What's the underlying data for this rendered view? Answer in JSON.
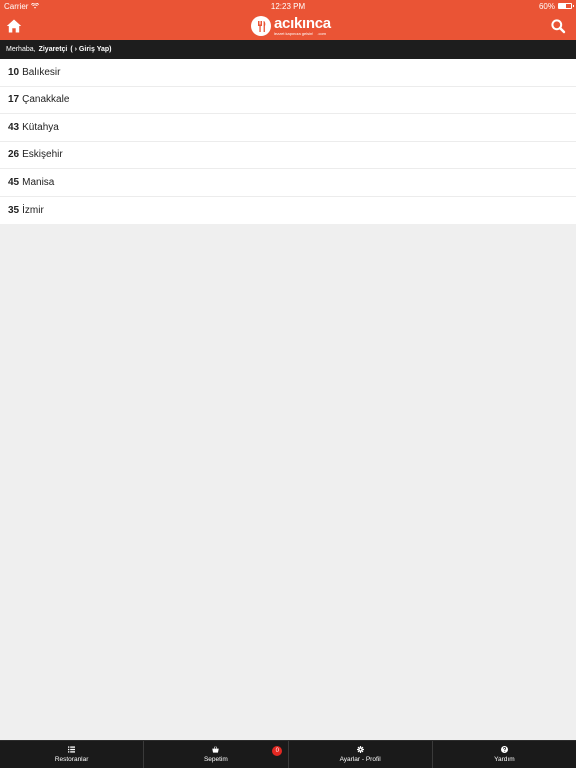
{
  "status_bar": {
    "carrier": "Carrier",
    "time": "12:23 PM",
    "battery": "60%",
    "battery_level": 0.6
  },
  "header": {
    "logo_text": "acıkınca",
    "logo_tagline": "lezzet kapınıza gelsin!",
    "logo_domain": ".com"
  },
  "greeting": {
    "prefix": "Merhaba,",
    "user": "Ziyaretçi",
    "login": "( › Giriş Yap)"
  },
  "cities": [
    {
      "code": "10",
      "name": "Balıkesir"
    },
    {
      "code": "17",
      "name": "Çanakkale"
    },
    {
      "code": "43",
      "name": "Kütahya"
    },
    {
      "code": "26",
      "name": "Eskişehir"
    },
    {
      "code": "45",
      "name": "Manisa"
    },
    {
      "code": "35",
      "name": "İzmir"
    }
  ],
  "tabs": {
    "restaurants": "Restoranlar",
    "cart": "Sepetim",
    "settings": "Ayarlar - Profil",
    "help": "Yardım"
  },
  "cart_count": "0",
  "colors": {
    "accent": "#ea5435",
    "dark": "#1a1a1a",
    "badge": "#e32822"
  }
}
